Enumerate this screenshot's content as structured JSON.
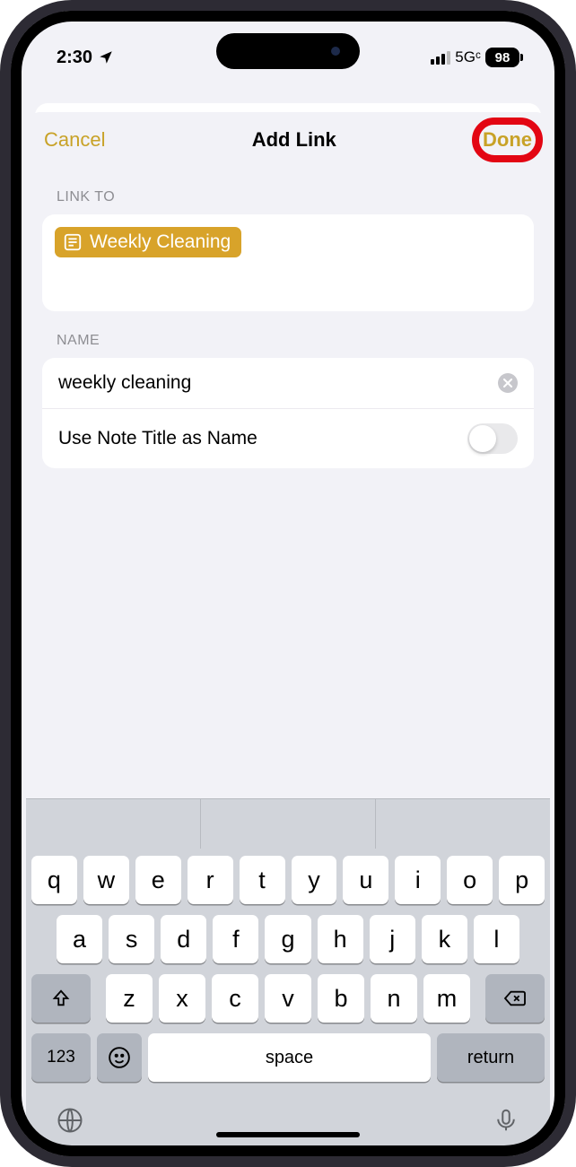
{
  "status": {
    "time": "2:30",
    "network": "5Gᶜ",
    "battery": "98"
  },
  "nav": {
    "cancel": "Cancel",
    "title": "Add Link",
    "done": "Done"
  },
  "sections": {
    "linkto_label": "LINK TO",
    "name_label": "NAME"
  },
  "link_chip": {
    "text": "Weekly Cleaning"
  },
  "name_field": {
    "value": "weekly cleaning"
  },
  "toggle": {
    "label": "Use Note Title as Name",
    "value": false
  },
  "keyboard": {
    "row1": [
      "q",
      "w",
      "e",
      "r",
      "t",
      "y",
      "u",
      "i",
      "o",
      "p"
    ],
    "row2": [
      "a",
      "s",
      "d",
      "f",
      "g",
      "h",
      "j",
      "k",
      "l"
    ],
    "row3": [
      "z",
      "x",
      "c",
      "v",
      "b",
      "n",
      "m"
    ],
    "k123": "123",
    "space": "space",
    "return": "return"
  }
}
